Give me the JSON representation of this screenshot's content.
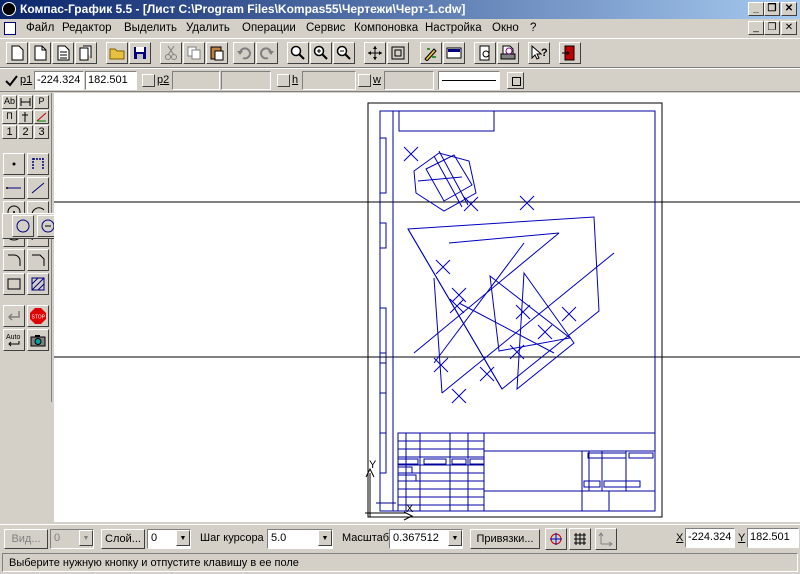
{
  "window": {
    "title": "Компас-График 5.5 - [Лист C:\\Program Files\\Kompas55\\Чертежи\\Черт-1.cdw]"
  },
  "menu": {
    "items": [
      "Файл",
      "Редактор",
      "Выделить",
      "Удалить",
      "Операции",
      "Сервис",
      "Компоновка",
      "Настройка",
      "Окно",
      "?"
    ]
  },
  "coords": {
    "p1_label": "p1",
    "p1_x": "-224.324",
    "p1_y": "182.501",
    "p2_label": "p2",
    "h_label": "h",
    "w_label": "w"
  },
  "left_panel": {
    "row3": [
      "1",
      "2",
      "3"
    ]
  },
  "bottom": {
    "view_label": "Вид...",
    "view_value": "0",
    "layer_label": "Слой...",
    "layer_value": "0",
    "step_label": "Шаг курсора",
    "step_value": "5.0",
    "scale_label": "Масштаб",
    "scale_value": "0.367512",
    "snap_label": "Привязки...",
    "x_label": "X",
    "x_value": "-224.324",
    "y_label": "Y",
    "y_value": "182.501"
  },
  "status": {
    "message": "Выберите нужную кнопку и отпустите клавишу в ее поле"
  },
  "drawing": {
    "axis_y": "Y",
    "axis_x": "X"
  }
}
